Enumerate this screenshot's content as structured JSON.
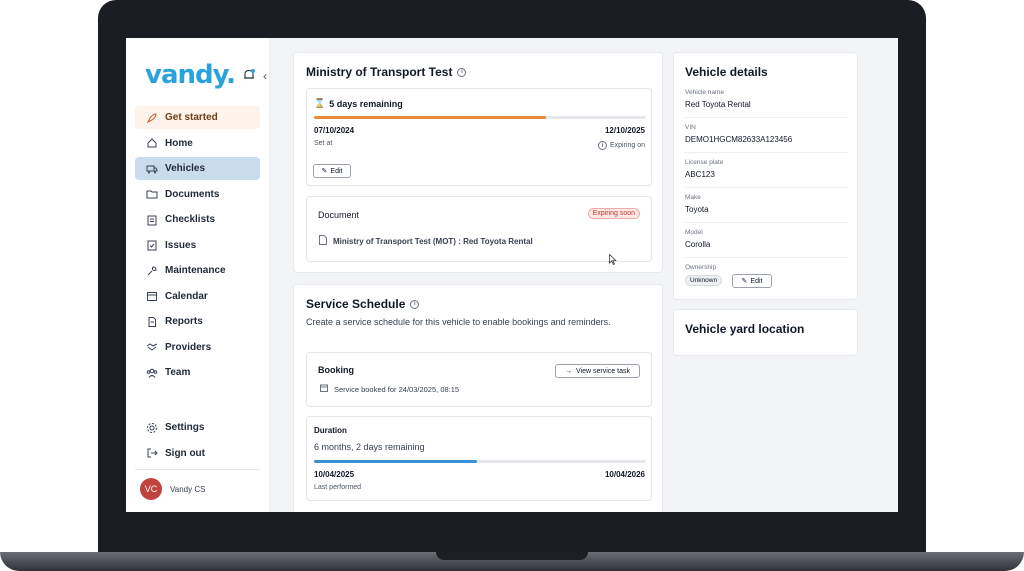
{
  "app": {
    "logo": "vandy."
  },
  "sidebar": {
    "items": [
      {
        "label": "Get started",
        "icon": "rocket-icon"
      },
      {
        "label": "Home",
        "icon": "home-icon"
      },
      {
        "label": "Vehicles",
        "icon": "truck-icon"
      },
      {
        "label": "Documents",
        "icon": "folder-icon"
      },
      {
        "label": "Checklists",
        "icon": "clipboard-icon"
      },
      {
        "label": "Issues",
        "icon": "clipboard-check-icon"
      },
      {
        "label": "Maintenance",
        "icon": "wrench-icon"
      },
      {
        "label": "Calendar",
        "icon": "calendar-icon"
      },
      {
        "label": "Reports",
        "icon": "report-icon"
      },
      {
        "label": "Providers",
        "icon": "handshake-icon"
      },
      {
        "label": "Team",
        "icon": "team-icon"
      }
    ],
    "bottom": [
      {
        "label": "Settings",
        "icon": "gear-icon"
      },
      {
        "label": "Sign out",
        "icon": "sign-out-icon"
      }
    ],
    "user": {
      "initials": "VC",
      "name": "Vandy CS"
    }
  },
  "mot": {
    "title": "Ministry of Transport Test",
    "remaining": "5 days remaining",
    "progress": 0.7,
    "start_date": "07/10/2024",
    "end_date": "12/10/2025",
    "start_label": "Set at",
    "end_label": "Expiring on",
    "edit": "Edit",
    "document_title": "Document",
    "badge": "Expiring soon",
    "document_name": "Ministry of Transport Test (MOT) : Red Toyota Rental"
  },
  "service": {
    "title": "Service Schedule",
    "description": "Create a service schedule for this vehicle to enable bookings and reminders.",
    "booking_title": "Booking",
    "view_task": "View service task",
    "booked_text": "Service booked for 24/03/2025, 08:15",
    "duration_title": "Duration",
    "duration_text": "6 months, 2 days remaining",
    "progress": 0.49,
    "start_date": "10/04/2025",
    "end_date": "10/04/2026",
    "last_label": "Last performed"
  },
  "vehicle": {
    "title": "Vehicle details",
    "fields": [
      {
        "label": "Vehicle name",
        "value": "Red Toyota Rental"
      },
      {
        "label": "VIN",
        "value": "DEMO1HGCM82633A123456"
      },
      {
        "label": "License plate",
        "value": "ABC123"
      },
      {
        "label": "Make",
        "value": "Toyota"
      },
      {
        "label": "Model",
        "value": "Corolla"
      }
    ],
    "ownership_label": "Ownership",
    "ownership_value": "Unknown",
    "edit": "Edit"
  },
  "yard": {
    "title": "Vehicle yard location"
  },
  "colors": {
    "accent": "#2aa3dd",
    "orange": "#f0893a",
    "blue": "#3d8fd6",
    "active": "#c9dcee"
  }
}
